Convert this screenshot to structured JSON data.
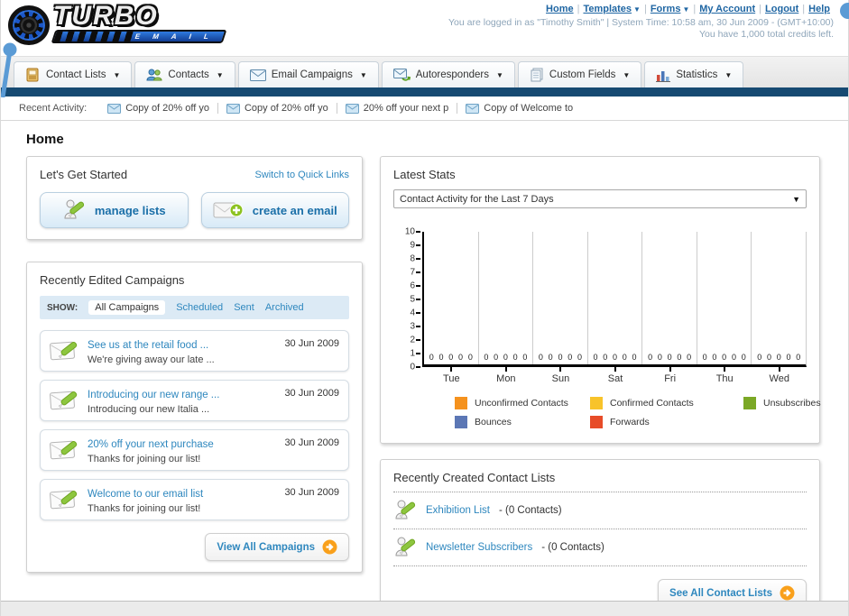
{
  "brand": {
    "name": "TURBO",
    "sub": "E M A I L"
  },
  "top_nav": {
    "links": [
      {
        "label": "Home",
        "dropdown": false
      },
      {
        "label": "Templates",
        "dropdown": true
      },
      {
        "label": "Forms",
        "dropdown": true
      },
      {
        "label": "My Account",
        "dropdown": false
      },
      {
        "label": "Logout",
        "dropdown": false
      },
      {
        "label": "Help",
        "dropdown": false
      }
    ],
    "login_info": "You are logged in as \"Timothy Smith\" | System Time: 10:58 am, 30 Jun 2009 - (GMT+10:00)",
    "credits": "You have 1,000 total credits left."
  },
  "tabs": [
    {
      "label": "Contact Lists",
      "icon": "contact-lists-icon"
    },
    {
      "label": "Contacts",
      "icon": "contacts-icon"
    },
    {
      "label": "Email Campaigns",
      "icon": "email-campaigns-icon"
    },
    {
      "label": "Autoresponders",
      "icon": "autoresponders-icon"
    },
    {
      "label": "Custom Fields",
      "icon": "custom-fields-icon"
    },
    {
      "label": "Statistics",
      "icon": "statistics-icon"
    }
  ],
  "recent_activity": {
    "label": "Recent Activity:",
    "items": [
      "Copy of 20% off yo",
      "Copy of 20% off yo",
      "20% off your next p",
      "Copy of Welcome to"
    ]
  },
  "page": {
    "title": "Home"
  },
  "get_started": {
    "title": "Let's Get Started",
    "switch_link": "Switch to Quick Links",
    "buttons": [
      {
        "label": "manage lists",
        "icon": "person-pencil-icon"
      },
      {
        "label": "create an email",
        "icon": "envelope-plus-icon"
      }
    ]
  },
  "campaigns": {
    "title": "Recently Edited Campaigns",
    "show_label": "SHOW:",
    "filters": [
      {
        "label": "All Campaigns",
        "active": true
      },
      {
        "label": "Scheduled",
        "active": false
      },
      {
        "label": "Sent",
        "active": false
      },
      {
        "label": "Archived",
        "active": false
      }
    ],
    "items": [
      {
        "title": "See us at the retail food ...",
        "subtitle": "We're giving away our late ...",
        "date": "30 Jun 2009"
      },
      {
        "title": "Introducing our new range ...",
        "subtitle": "Introducing our new Italia ...",
        "date": "30 Jun 2009"
      },
      {
        "title": "20% off your next purchase",
        "subtitle": "Thanks for joining our list!",
        "date": "30 Jun 2009"
      },
      {
        "title": "Welcome to our email list",
        "subtitle": "Thanks for joining our list!",
        "date": "30 Jun 2009"
      }
    ],
    "view_all_label": "View All Campaigns"
  },
  "stats": {
    "title": "Latest Stats",
    "dropdown_value": "Contact Activity for the Last 7 Days"
  },
  "chart_data": {
    "type": "bar",
    "title": "Contact Activity for the Last 7 Days",
    "categories": [
      "Tue",
      "Mon",
      "Sun",
      "Sat",
      "Fri",
      "Thu",
      "Wed"
    ],
    "series": [
      {
        "name": "Unconfirmed Contacts",
        "color": "#F5921E",
        "values": [
          0,
          0,
          0,
          0,
          0,
          0,
          0
        ]
      },
      {
        "name": "Confirmed Contacts",
        "color": "#F8C32A",
        "values": [
          0,
          0,
          0,
          0,
          0,
          0,
          0
        ]
      },
      {
        "name": "Unsubscribes",
        "color": "#7BA826",
        "values": [
          0,
          0,
          0,
          0,
          0,
          0,
          0
        ]
      },
      {
        "name": "Bounces",
        "color": "#5C77B5",
        "values": [
          0,
          0,
          0,
          0,
          0,
          0,
          0
        ]
      },
      {
        "name": "Forwards",
        "color": "#E74C28",
        "values": [
          0,
          0,
          0,
          0,
          0,
          0,
          0
        ]
      }
    ],
    "xlabel": "",
    "ylabel": "",
    "ylim": [
      0,
      10
    ],
    "yticks": [
      0,
      1,
      2,
      3,
      4,
      5,
      6,
      7,
      8,
      9,
      10
    ],
    "grid": "vertical",
    "legend_position": "bottom",
    "data_labels": "each bar group shows five 0 values above the baseline"
  },
  "contact_lists": {
    "title": "Recently Created Contact Lists",
    "items": [
      {
        "name": "Exhibition List",
        "suffix": " - (0 Contacts)"
      },
      {
        "name": "Newsletter Subscribers",
        "suffix": " - (0 Contacts)"
      }
    ],
    "see_all_label": "See All Contact Lists"
  },
  "icons": {
    "envelope-icon": "blue envelope glyph",
    "envelope-pencil-icon": "white envelope with green pencil",
    "person-pencil-icon": "gray person outline with green pencil",
    "envelope-plus-icon": "envelope with green plus badge",
    "arrow-circle-icon": "orange circle with white right arrow",
    "dropdown-caret-icon": "small down triangle",
    "contact-lists-icon": "tan address book",
    "contacts-icon": "two people",
    "email-campaigns-icon": "envelope outline",
    "autoresponders-icon": "envelope with green arrow",
    "custom-fields-icon": "stacked pages",
    "statistics-icon": "mini bar chart"
  },
  "colors": {
    "navy_bar": "#164a72",
    "link_blue": "#2e87be",
    "top_link_blue": "#1f66a3",
    "button_text_blue": "#1a6fa8",
    "show_bar_bg": "#dceaf5",
    "annotation_blue": "#5b9bd5",
    "arrow_orange": "#f9a01b"
  }
}
